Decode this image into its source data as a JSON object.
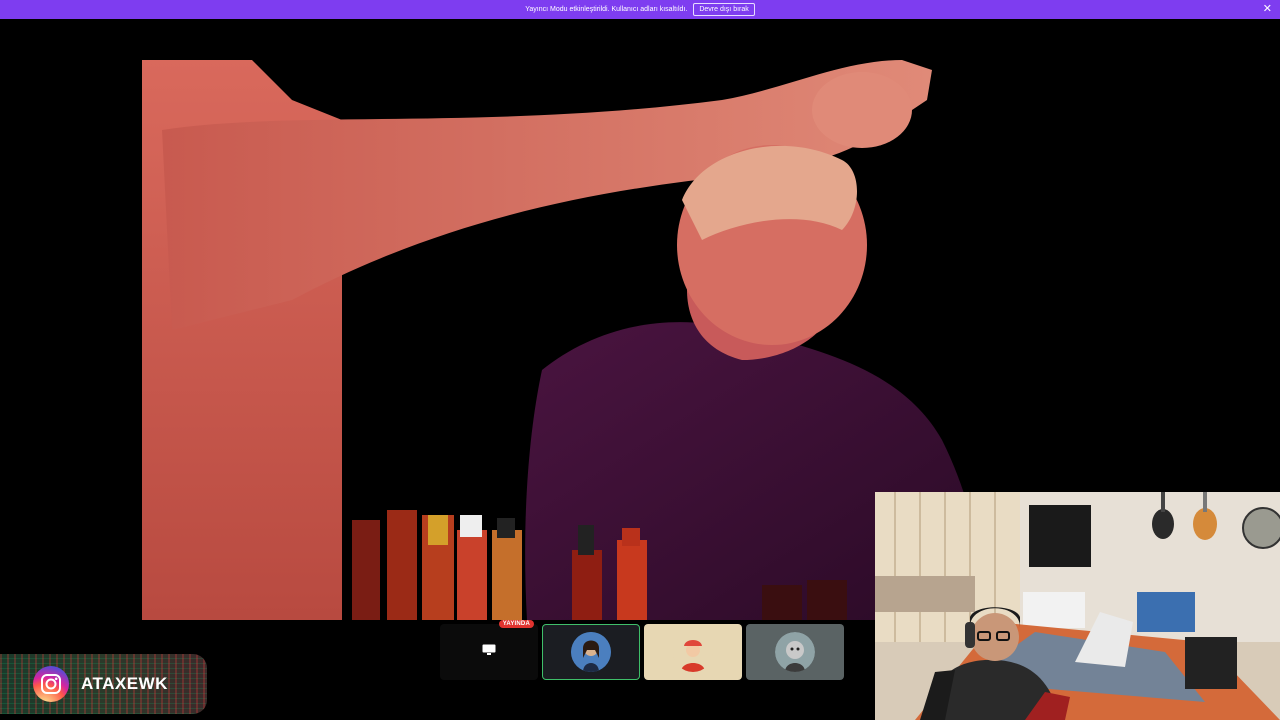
{
  "banner": {
    "message": "Yayıncı Modu etkinleştirildi. Kullanıcı adları kısaltıldı.",
    "disable_label": "Devre dışı bırak",
    "close_icon": "close-icon",
    "color": "#7e3df0"
  },
  "stream": {
    "tiles": [
      {
        "type": "screen-share",
        "icon": "monitor-icon",
        "badge": "YAYINDA"
      },
      {
        "type": "participant",
        "icon": "avatar",
        "active": true,
        "accent": "#3fbf6a"
      },
      {
        "type": "participant",
        "icon": "avatar"
      },
      {
        "type": "participant",
        "icon": "avatar"
      }
    ]
  },
  "overlay": {
    "instagram_icon": "instagram-icon",
    "handle": "ATAXEWK"
  }
}
